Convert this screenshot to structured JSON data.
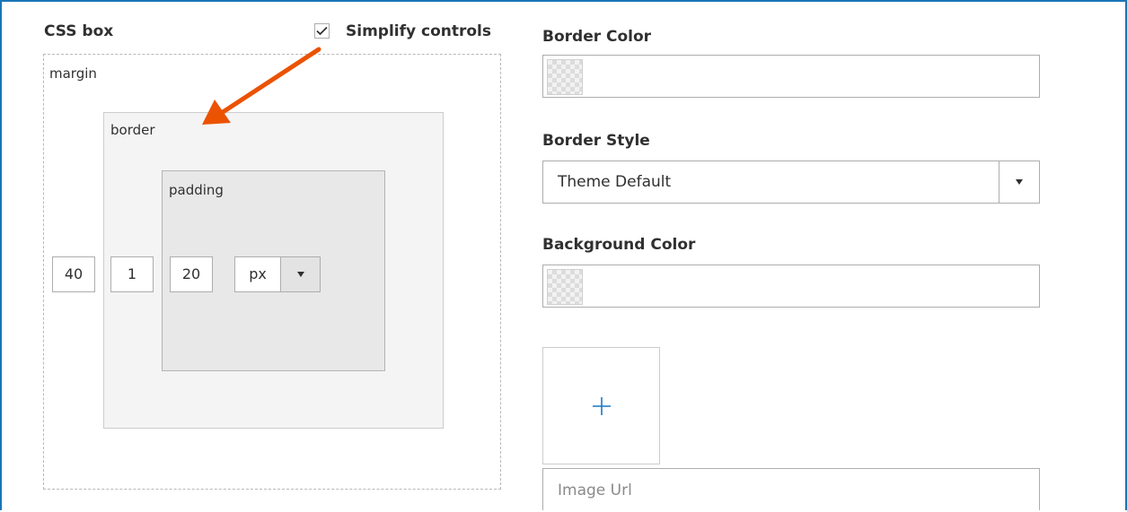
{
  "left_panel": {
    "title": "CSS box",
    "simplify_checkbox": {
      "label": "Simplify controls",
      "checked": true
    },
    "labels": {
      "margin": "margin",
      "border": "border",
      "padding": "padding"
    },
    "values": {
      "margin": "40",
      "border": "1",
      "padding": "20",
      "unit": "px"
    }
  },
  "right_panel": {
    "border_color": {
      "label": "Border Color"
    },
    "border_style": {
      "label": "Border Style",
      "value": "Theme Default"
    },
    "background_color": {
      "label": "Background Color"
    },
    "image_url": {
      "placeholder": "Image Url"
    }
  },
  "colors": {
    "frame_border": "#1a75b8",
    "annotation_arrow": "#eb5202",
    "upload_icon": "#1979c3"
  },
  "icons": {
    "upload": "plus-icon",
    "dropdown": "caret-down-icon",
    "check": "checkmark-icon"
  }
}
